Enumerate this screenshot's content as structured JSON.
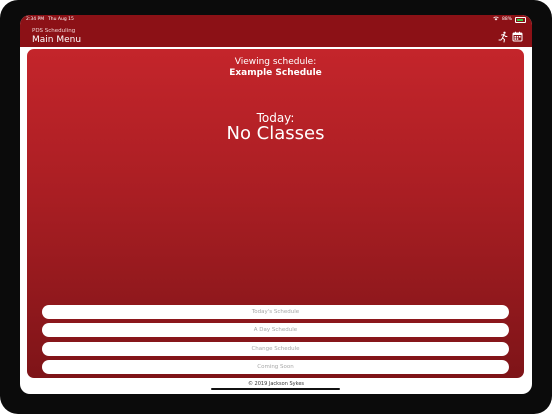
{
  "status_bar": {
    "time": "2:34 PM",
    "date": "Thu Aug 15",
    "battery": "88%",
    "wifi_icon": "wifi-icon",
    "battery_icon": "battery-icon"
  },
  "navbar": {
    "subtitle": "PDS Scheduling",
    "title": "Main Menu",
    "icons": [
      "runner-icon",
      "calendar-icon"
    ]
  },
  "schedule": {
    "viewing_label": "Viewing schedule:",
    "viewing_name": "Example Schedule",
    "today_label": "Today:",
    "today_value": "No Classes"
  },
  "menu": [
    {
      "label": "Today's Schedule"
    },
    {
      "label": "A Day Schedule"
    },
    {
      "label": "Change Schedule"
    },
    {
      "label": "Coming Soon"
    }
  ],
  "footer": {
    "copyright": "© 2019 Jackson Sykes"
  },
  "colors": {
    "header": "#8c1116",
    "card_top": "#c4252b",
    "card_bottom": "#7e1418",
    "button_text": "#a7a7a7"
  }
}
